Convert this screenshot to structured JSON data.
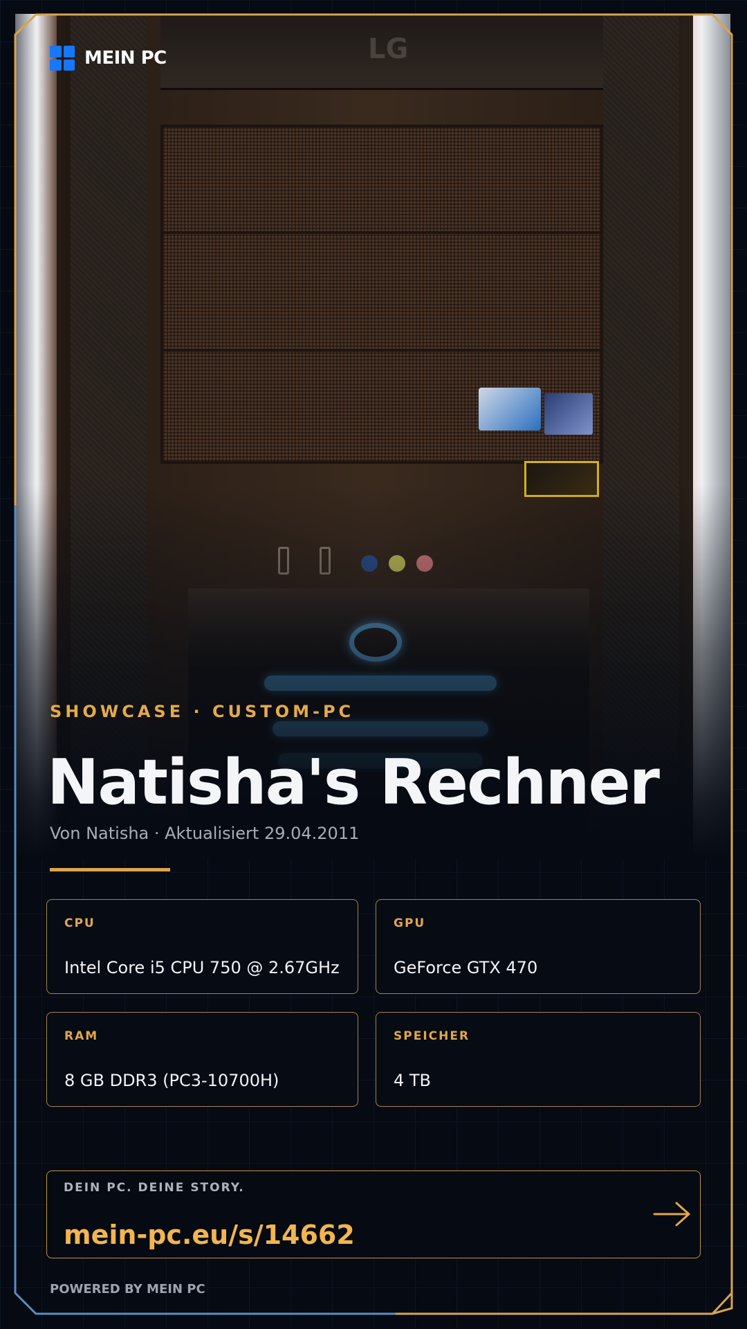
{
  "brand": {
    "name": "MEIN PC"
  },
  "hero": {
    "kicker": "SHOWCASE · CUSTOM-PC",
    "title": "Natisha's Rechner",
    "meta": "Von Natisha · Aktualisiert 29.04.2011",
    "photo_brand": "LG"
  },
  "specs": [
    {
      "label": "CPU",
      "value": "Intel Core i5 CPU 750 @ 2.67GHz"
    },
    {
      "label": "GPU",
      "value": "GeForce GTX 470"
    },
    {
      "label": "RAM",
      "value": "8 GB DDR3 (PC3-10700H)"
    },
    {
      "label": "SPEICHER",
      "value": "4 TB"
    }
  ],
  "cta": {
    "tag": "DEIN PC. DEINE STORY.",
    "url": "mein-pc.eu/s/14662",
    "icon": "arrow-right-icon"
  },
  "footer": {
    "text": "POWERED BY MEIN PC"
  },
  "colors": {
    "accent": "#e3a64a",
    "brand_blue": "#1677ff",
    "frame_blue": "#5b8dbf",
    "background": "#050a13"
  }
}
